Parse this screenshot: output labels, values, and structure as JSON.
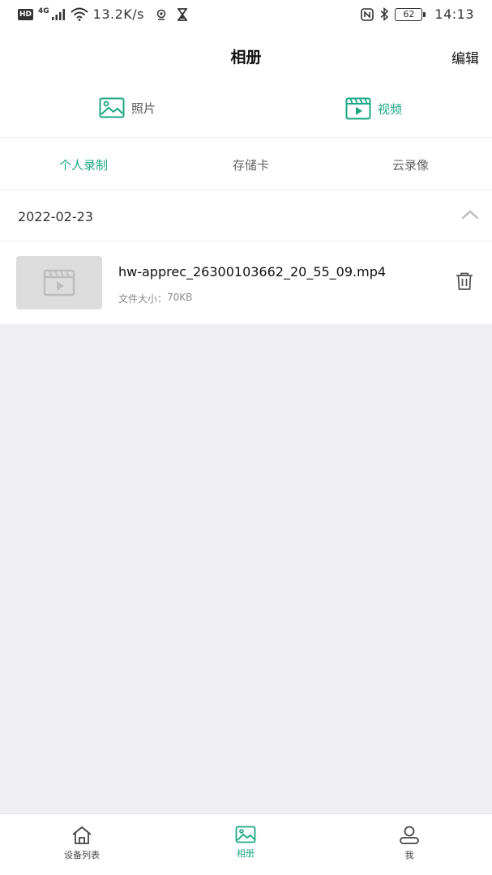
{
  "status_bar": {
    "hd": "HD",
    "network": "4G",
    "speed": "13.2K/s",
    "battery": "62",
    "time": "14:13"
  },
  "nav": {
    "title": "相册",
    "edit_label": "编辑"
  },
  "media_types": [
    {
      "label": "照片",
      "icon": "image-icon",
      "active": false
    },
    {
      "label": "视频",
      "icon": "video-icon",
      "active": true
    }
  ],
  "sub_tabs": [
    {
      "label": "个人录制",
      "active": true
    },
    {
      "label": "存储卡",
      "active": false
    },
    {
      "label": "云录像",
      "active": false
    }
  ],
  "section": {
    "date": "2022-02-23",
    "expanded": true
  },
  "files": [
    {
      "name": "hw-apprec_26300103662_20_55_09.mp4",
      "size_label": "文件大小：",
      "size_value": "70KB"
    }
  ],
  "bottom_tabs": [
    {
      "label": "设备列表",
      "icon": "home-icon",
      "active": false
    },
    {
      "label": "相册",
      "icon": "image-icon",
      "active": true
    },
    {
      "label": "我",
      "icon": "user-icon",
      "active": false
    }
  ],
  "colors": {
    "accent": "#1ba784",
    "background": "#efeff3",
    "text": "#222222"
  }
}
